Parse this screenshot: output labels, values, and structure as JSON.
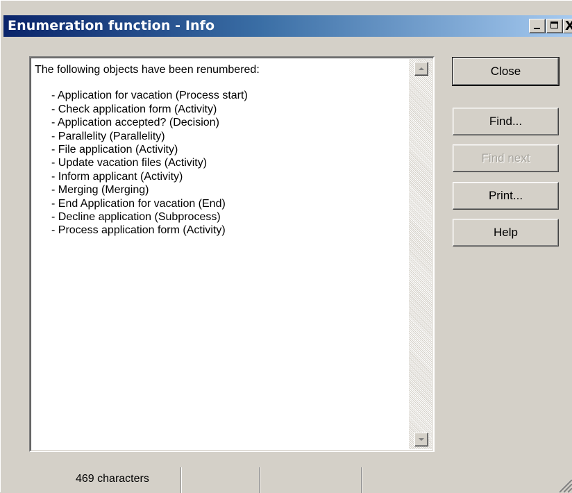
{
  "window": {
    "title": "Enumeration function - Info",
    "controls": {
      "minimize": "_",
      "maximize": "□",
      "close": "X"
    }
  },
  "textbox": {
    "header": "The following objects have been renumbered:",
    "items": [
      "- Application for vacation (Process start)",
      "- Check application form (Activity)",
      "- Application accepted? (Decision)",
      "- Parallelity (Parallelity)",
      "- File application (Activity)",
      "- Update vacation files (Activity)",
      "- Inform applicant (Activity)",
      "- Merging (Merging)",
      "- End Application for vacation (End)",
      "- Decline application (Subprocess)",
      "- Process application form (Activity)"
    ]
  },
  "buttons": {
    "close": "Close",
    "find": "Find...",
    "find_next": "Find next",
    "print": "Print...",
    "help": "Help"
  },
  "statusbar": {
    "char_count": "469 characters"
  },
  "icons": {
    "scroll_up": "scroll-up-arrow-icon",
    "scroll_down": "scroll-down-arrow-icon",
    "resize": "resize-grip-icon"
  },
  "colors": {
    "title_gradient_start": "#0a246a",
    "title_gradient_end": "#a6caf0",
    "face": "#d4d0c8"
  }
}
